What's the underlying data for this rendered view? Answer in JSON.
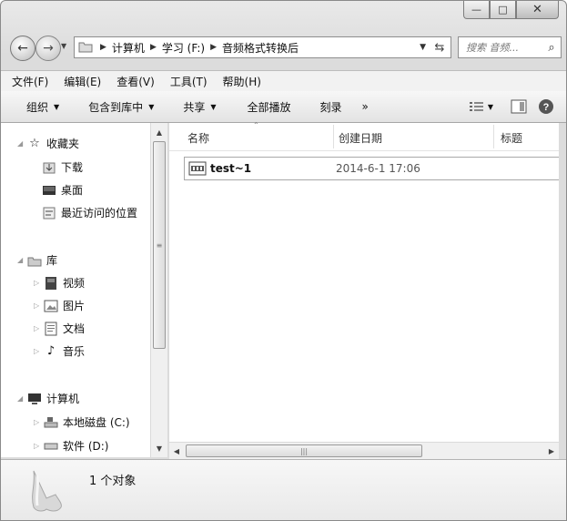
{
  "window": {
    "caption": {
      "minimize": "—",
      "maximize": "□",
      "close": "✕"
    }
  },
  "address": {
    "segments": [
      "计算机",
      "学习 (F:)",
      "音频格式转换后"
    ],
    "search_placeholder": "搜索 音频...",
    "icons": {
      "back": "arrow-left-icon",
      "forward": "arrow-right-icon",
      "refresh": "refresh-icon",
      "search": "search-icon"
    }
  },
  "menu": [
    "文件(F)",
    "编辑(E)",
    "查看(V)",
    "工具(T)",
    "帮助(H)"
  ],
  "toolbar": {
    "organize": "组织",
    "include_library": "包含到库中",
    "share": "共享",
    "play_all": "全部播放",
    "burn": "刻录",
    "more": "»"
  },
  "nav": {
    "favorites": "收藏夹",
    "downloads": "下载",
    "desktop": "桌面",
    "recent": "最近访问的位置",
    "libraries": "库",
    "videos": "视频",
    "pictures": "图片",
    "documents": "文档",
    "music": "音乐",
    "computer": "计算机",
    "local_disk": "本地磁盘 (C:)",
    "software": "软件 (D:)"
  },
  "columns": {
    "name": "名称",
    "date": "创建日期",
    "title": "标题"
  },
  "files": [
    {
      "name": "test~1",
      "date": "2014-6-1 17:06"
    }
  ],
  "status": {
    "count": "1 个对象"
  }
}
